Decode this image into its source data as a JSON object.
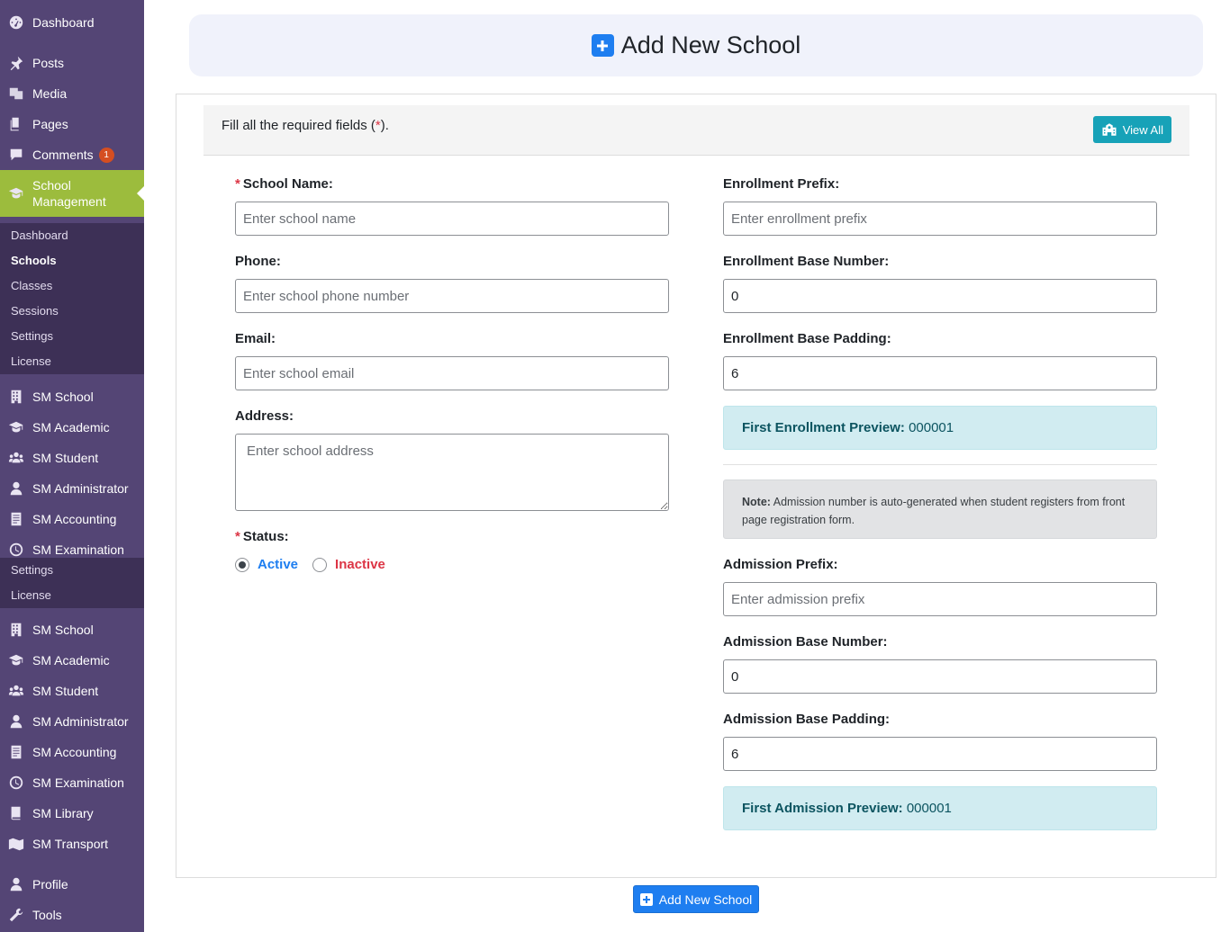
{
  "sidebar": {
    "top_items": [
      {
        "label": "Dashboard",
        "icon": "dashboard-icon"
      },
      {
        "label": "Posts",
        "icon": "pin-icon"
      },
      {
        "label": "Media",
        "icon": "media-icon"
      },
      {
        "label": "Pages",
        "icon": "pages-icon"
      },
      {
        "label": "Comments",
        "icon": "comments-icon",
        "badge": "1"
      }
    ],
    "active_item": {
      "label": "School Management",
      "icon": "graduation-cap-icon"
    },
    "active_submenu": [
      "Dashboard",
      "Schools",
      "Classes",
      "Sessions",
      "Settings",
      "License"
    ],
    "group1": [
      "SM School",
      "SM Academic",
      "SM Student",
      "SM Administrator",
      "SM Accounting",
      "SM Examination"
    ],
    "group1_submenu": [
      "Settings",
      "License"
    ],
    "group2": [
      "SM School",
      "SM Academic",
      "SM Student",
      "SM Administrator",
      "SM Accounting",
      "SM Examination",
      "SM Library",
      "SM Transport"
    ],
    "bottom_items": [
      "Profile",
      "Tools"
    ]
  },
  "header": {
    "title": "Add New School"
  },
  "card": {
    "instruction_prefix": "Fill all the required fields (",
    "instruction_star": "*",
    "instruction_suffix": ").",
    "view_all_label": "View All"
  },
  "form": {
    "left": {
      "school_name_label": "School Name:",
      "school_name_placeholder": "Enter school name",
      "phone_label": "Phone:",
      "phone_placeholder": "Enter school phone number",
      "email_label": "Email:",
      "email_placeholder": "Enter school email",
      "address_label": "Address:",
      "address_placeholder": "Enter school address",
      "status_label": "Status:",
      "status_active": "Active",
      "status_inactive": "Inactive",
      "status_selected": "Active"
    },
    "right": {
      "enrollment_prefix_label": "Enrollment Prefix:",
      "enrollment_prefix_placeholder": "Enter enrollment prefix",
      "enrollment_base_number_label": "Enrollment Base Number:",
      "enrollment_base_number_value": "0",
      "enrollment_base_padding_label": "Enrollment Base Padding:",
      "enrollment_base_padding_value": "6",
      "enrollment_preview_label": "First Enrollment Preview:",
      "enrollment_preview_value": "000001",
      "note_label": "Note:",
      "note_text": "Admission number is auto-generated when student registers from front page registration form.",
      "admission_prefix_label": "Admission Prefix:",
      "admission_prefix_placeholder": "Enter admission prefix",
      "admission_base_number_label": "Admission Base Number:",
      "admission_base_number_value": "0",
      "admission_base_padding_label": "Admission Base Padding:",
      "admission_base_padding_value": "6",
      "admission_preview_label": "First Admission Preview:",
      "admission_preview_value": "000001"
    }
  },
  "submit_label": "Add New School",
  "colors": {
    "sidebar": "#544575",
    "active_menu": "#9cbc3d",
    "primary": "#1e7ef0",
    "info": "#17a2b8",
    "danger": "#dc3545"
  }
}
